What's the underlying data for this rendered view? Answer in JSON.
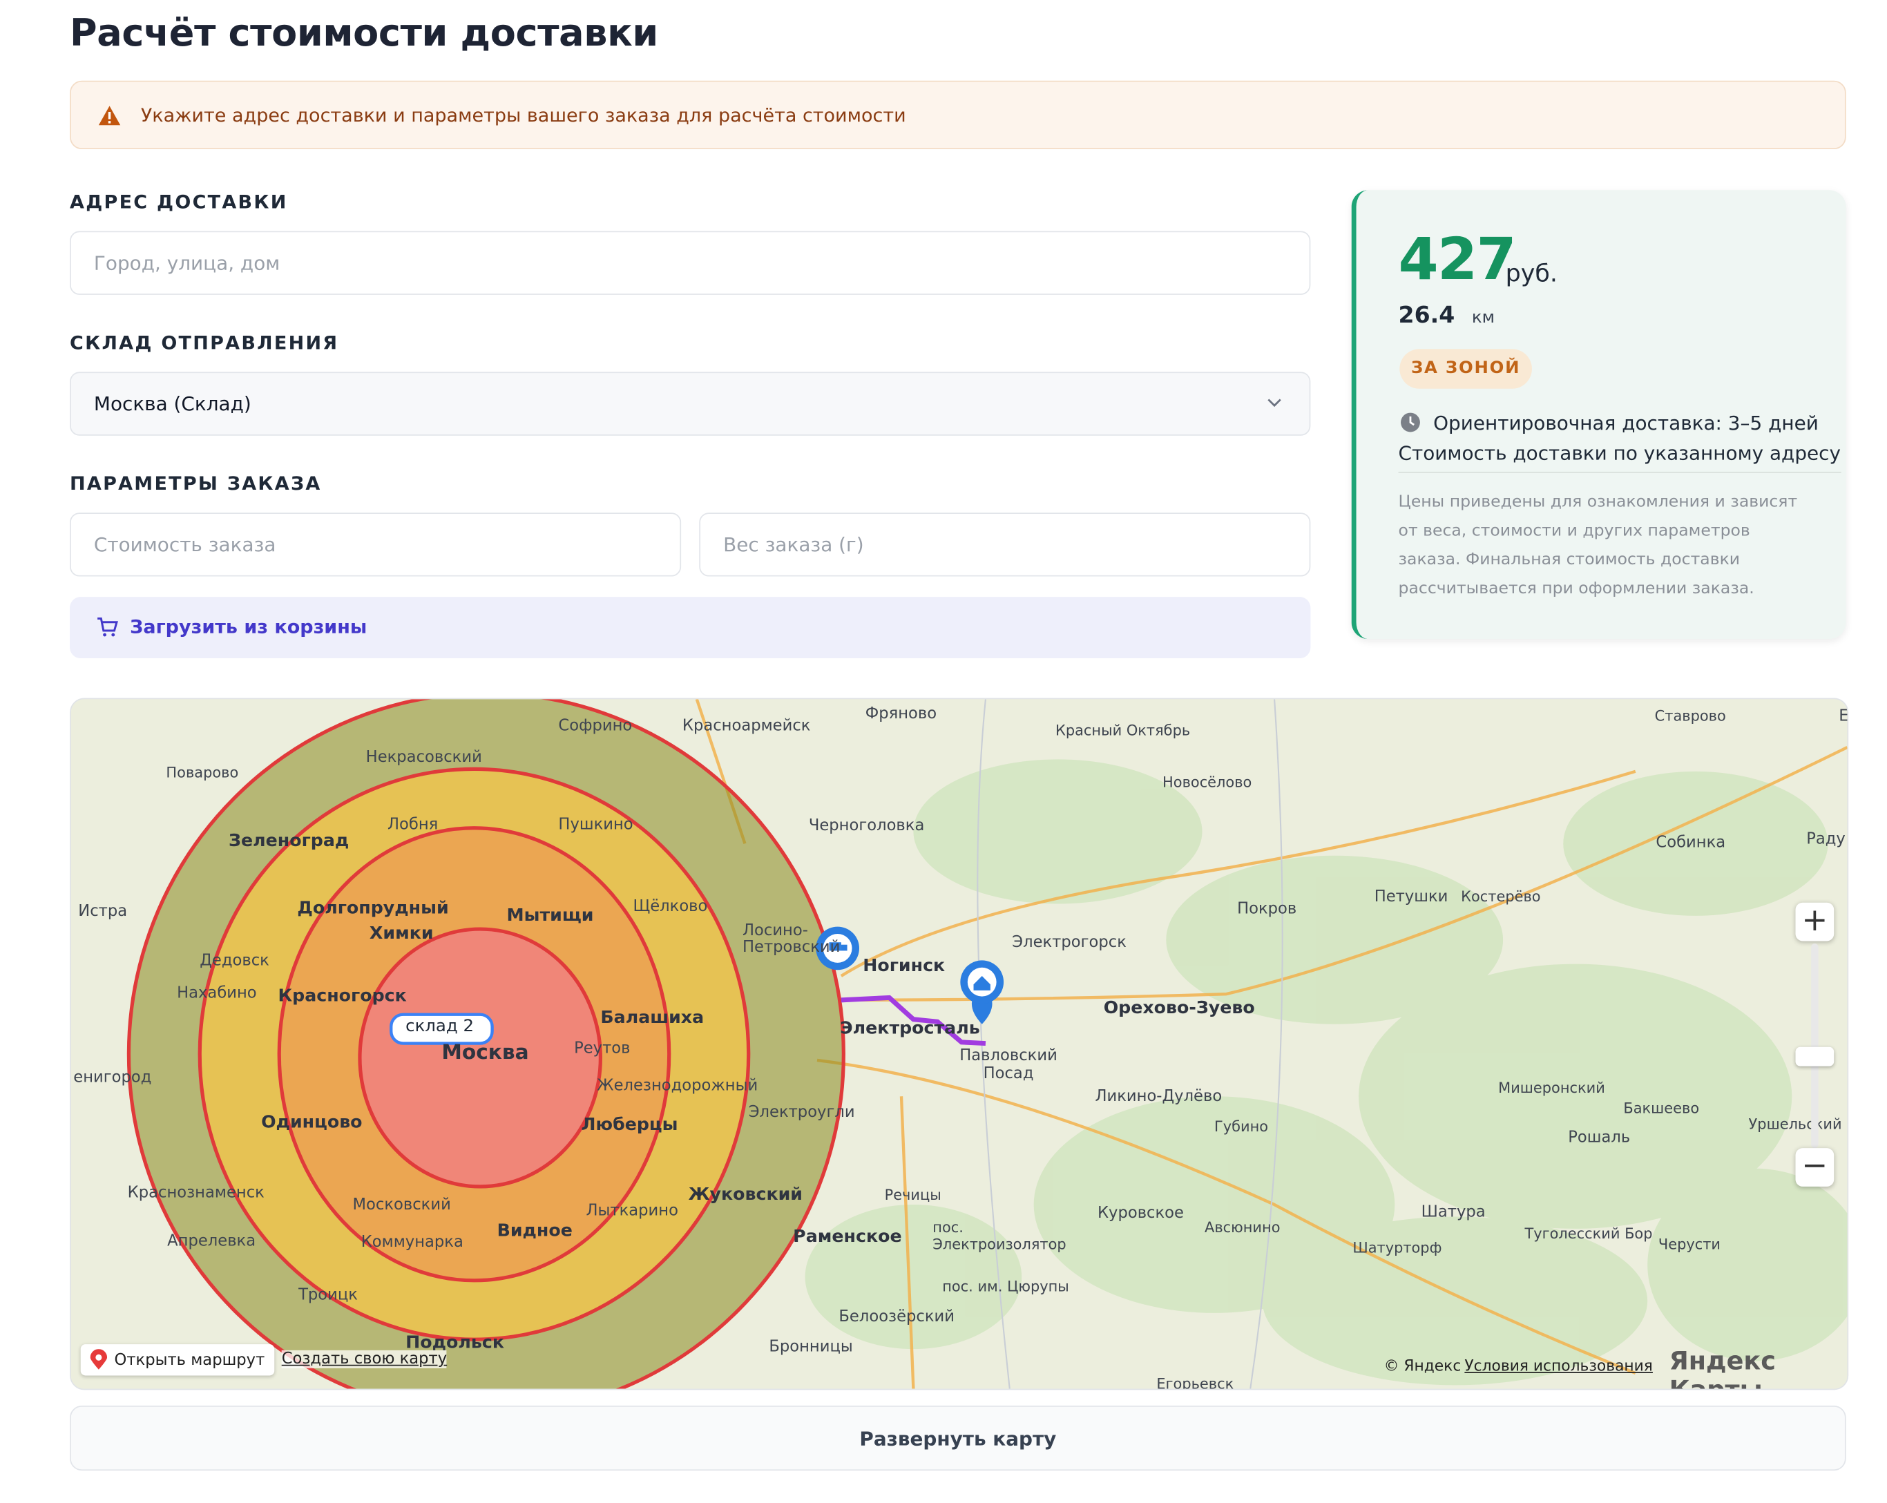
{
  "page": {
    "title": "Расчёт стоимости доставки"
  },
  "alert": {
    "text": "Укажите адрес доставки и параметры вашего заказа для расчёта стоимости"
  },
  "address": {
    "label": "АДРЕС ДОСТАВКИ",
    "placeholder": "Город, улица, дом",
    "value": ""
  },
  "warehouse": {
    "label": "СКЛАД ОТПРАВЛЕНИЯ",
    "selected": "Москва (Склад)"
  },
  "order": {
    "label": "ПАРАМЕТРЫ ЗАКАЗА",
    "cost_placeholder": "Стоимость заказа",
    "weight_placeholder": "Вес заказа (г)",
    "cart_button": "Загрузить из корзины"
  },
  "result": {
    "price": "427",
    "currency": "руб.",
    "distance": "26.4",
    "distance_unit": "км",
    "zone_badge": "ЗА ЗОНОЙ",
    "eta": "Ориентировочная доставка: 3–5 дней",
    "description": "Стоимость доставки по указанному адресу",
    "note": "Цены приведены для ознакомления и зависят от веса, стоимости и других параметров заказа. Финальная стоимость доставки рассчитывается при оформлении заказа."
  },
  "map": {
    "labels": {
      "moscow": "Москва",
      "sofrino": "Софрино",
      "krasnoarmeysk": "Красноармейск",
      "fryanovo": "Фряново",
      "krasny_oktyabr": "Красный Октябрь",
      "stavrovo": "Ставрово",
      "povarovo": "Поварово",
      "nekrasovsky": "Некрасовский",
      "novoselovo": "Новосёлово",
      "zelenograd": "Зеленоград",
      "lobnya": "Лобня",
      "pushkino": "Пушкино",
      "chernogolovka": "Черноголовка",
      "sobinka": "Собинка",
      "istra": "Истра",
      "dolgoprudny": "Долгопрудный",
      "khimki": "Химки",
      "mytishchi": "Мытищи",
      "shchelkovo": "Щёлково",
      "losino": "Лосино-Петровский",
      "pokrov": "Покров",
      "petushki": "Петушки",
      "kosterevo": "Костерёво",
      "elektrogorsk": "Электрогорск",
      "noginsk": "Ногинск",
      "dedovsk": "Дедовск",
      "nakhabino": "Нахабино",
      "krasnogorsk": "Красногорск",
      "balashikha": "Балашиха",
      "elektrostal": "Электросталь",
      "orekhovo": "Орехово-Зуево",
      "pavlovsky": "Павловский Посад",
      "reutov": "Реутов",
      "zheleznodorozhny": "Железнодорожный",
      "elektrougli": "Электроугли",
      "likino": "Ликино-Дулёво",
      "misheronsky": "Мишеронский",
      "bakshеevo": "Бакшеево",
      "roshal": "Рошаль",
      "urshelsky": "Уршельский",
      "odintsovo": "Одинцово",
      "lyubertsy": "Люберцы",
      "gubino": "Губино",
      "krasnoznamensk": "Краснознаменск",
      "zhukovsky": "Жуковский",
      "rechitsy": "Речицы",
      "moskovsky": "Московский",
      "lytkarino": "Лыткарино",
      "kurovskoe": "Куровское",
      "avsyunino": "Авсюнино",
      "shatura": "Шатура",
      "aprelevka": "Апрелевка",
      "kommunarka": "Коммунарка",
      "vidnoe": "Видное",
      "ramenskoe": "Раменское",
      "elektroizolyator": "пос. Электроизолятор",
      "tugolessky": "Туголесский Бор",
      "cherusti": "Черусти",
      "shaturtorf": "Шатурторф",
      "troitsk": "Троицк",
      "tsyurupy": "пос. им. Цюрупы",
      "beloozersky": "Белоозёрский",
      "podolsk": "Подольск",
      "bronnitsy": "Бронницы",
      "egoryevsk": "Егорьевск",
      "raduzhny": "Раду",
      "vyazniki": "Е",
      "enigorod": "енигород"
    },
    "warehouse_tag": "склад 2",
    "open_route": "Открыть маршрут",
    "create_map": "Создать свою карту",
    "copyright": "© Яндекс",
    "terms": "Условия использования",
    "logo": "Яндекс Карты",
    "zoom_in": "+",
    "zoom_out": "−",
    "expand_button": "Развернуть карту"
  },
  "colors": {
    "accent_green": "#15935f",
    "accent_indigo": "#4338ca",
    "zone_badge": "#c16417",
    "route": "#a13ce0"
  }
}
